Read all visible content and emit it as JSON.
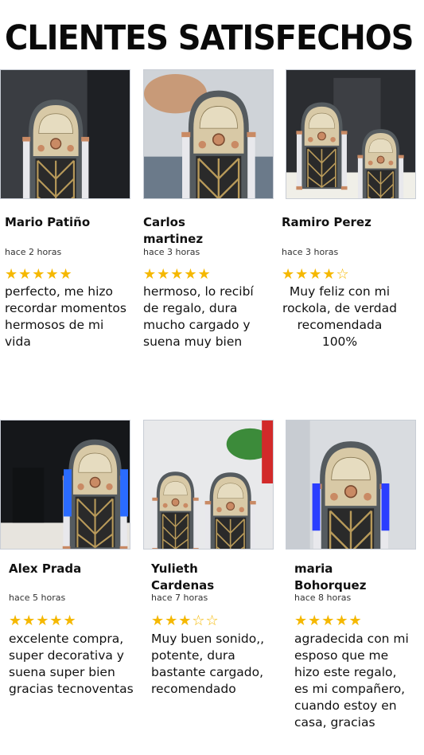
{
  "page": {
    "title": "CLIENTES SATISFECHOS",
    "star_color": "#f5b800"
  },
  "reviews": [
    {
      "name": "Mario Patiño",
      "time": "hace 2 horas",
      "rating": 5,
      "stars": "★★★★★",
      "text": "perfecto, me hizo recordar momentos hermosos de mi vida",
      "photo": "jukebox-in-box-photo"
    },
    {
      "name": "Carlos martinez",
      "time": "hace 3 horas",
      "rating": 5,
      "stars": "★★★★★",
      "text": "hermoso, lo recibí de regalo, dura mucho cargado y suena muy bien",
      "photo": "hand-holding-jukebox-photo"
    },
    {
      "name": "Ramiro Perez",
      "time": "hace 3 horas",
      "rating": 4,
      "stars": "★★★★☆",
      "text": "Muy feliz con mi rockola, de verdad recomendada 100%",
      "photo": "two-jukeboxes-photo"
    },
    {
      "name": "Alex Prada",
      "time": "hace 5 horas",
      "rating": 5,
      "stars": "★★★★★",
      "text": "excelente compra, super decorativa y suena super bien gracias tecnoventas",
      "photo": "jukebox-blue-light-photo"
    },
    {
      "name": "Yulieth Cardenas",
      "time": "hace 7 horas",
      "rating": 3,
      "stars": "★★★☆☆",
      "text": "Muy buen sonido,, potente, dura bastante cargado, recomendado",
      "photo": "jukebox-with-plant-photo"
    },
    {
      "name": "maria Bohorquez",
      "time": "hace 8 horas",
      "rating": 5,
      "stars": "★★★★★",
      "text": "agradecida con mi esposo que me hizo este regalo, es mi compañero, cuando estoy en casa,  gracias",
      "photo": "jukebox-glowing-photo"
    }
  ]
}
